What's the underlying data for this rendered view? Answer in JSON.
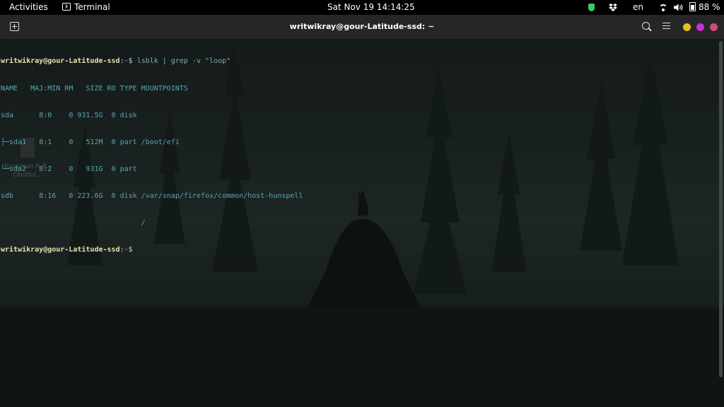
{
  "topbar": {
    "activities": "Activities",
    "app_name": "Terminal",
    "clock": "Sat Nov 19  14:14:25",
    "language": "en",
    "battery": "88 %"
  },
  "window": {
    "title": "writwikray@gour-Latitude-ssd: ~"
  },
  "terminal": {
    "prompt_user": "writwikray@gour-Latitude-ssd",
    "prompt_sep": ":",
    "prompt_path": "~",
    "prompt_symbol": "$ ",
    "command": "lsblk | grep -v \"loop\"",
    "output_lines": [
      "NAME   MAJ:MIN RM   SIZE RO TYPE MOUNTPOINTS",
      "sda      8:0    0 931.5G  0 disk",
      "├─sda1   8:1    0   512M  0 part /boot/efi",
      "└─sda2   8:2    0   931G  0 part",
      "sdb      8:16   0 223.6G  0 disk /var/snap/firefox/common/host-hunspell",
      "                                 /"
    ]
  },
  "desktop": {
    "file_label": "Krugman P. R., Obstfel..."
  },
  "colors": {
    "prompt_user": "#e8e1b4",
    "output": "#5aa6b0",
    "minimize": "#e4c317",
    "maximize": "#c432d8",
    "close": "#d24b7a"
  },
  "icons": {
    "app": "terminal-icon",
    "shield": "shield-icon",
    "dropbox": "dropbox-icon",
    "wifi": "wifi-icon",
    "volume": "volume-icon",
    "battery": "battery-icon",
    "new_tab": "new-tab-icon",
    "search": "search-icon",
    "menu": "hamburger-menu-icon"
  }
}
